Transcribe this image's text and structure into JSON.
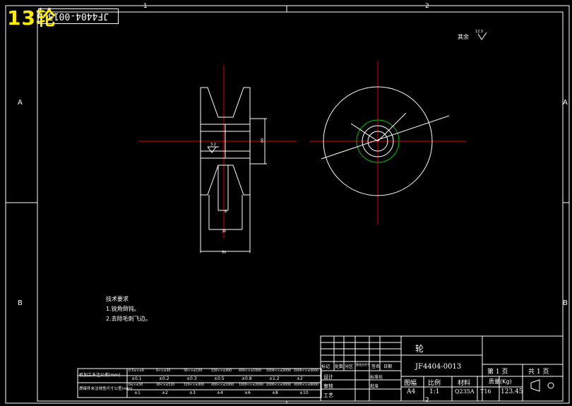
{
  "overlay": {
    "label": "13轮"
  },
  "code_box": {
    "text": "JF4404-0013"
  },
  "frame": {
    "col_top_1": "1",
    "col_top_2": "2",
    "col_bot_1": "1",
    "col_bot_2": "2",
    "row_left_a": "A",
    "row_left_b": "B",
    "row_right_a": "A",
    "row_right_b": "B"
  },
  "roughness": {
    "label": "其余",
    "value": "12.5"
  },
  "section_view": {
    "roughness_value": "3.2"
  },
  "tech_requirements": {
    "title": "技术要求",
    "items": [
      "1.锐角倒钝。",
      "2.去除毛刺飞边。"
    ]
  },
  "tolerance_table": {
    "row1_label": "机加工未注公差(mm)",
    "row1_ranges": [
      "0.5≤×≤6",
      "6<×≤30",
      "30<×≤120",
      "120<×≤400",
      "400<×≤1000",
      "1000<×≤2000",
      "2000<×≤4000"
    ],
    "row1_values": [
      "±0.1",
      "±0.2",
      "±0.3",
      "±0.5",
      "±0.8",
      "±1.2",
      "±2"
    ],
    "row2_label": "焊接件未注线性尺寸公差(mm)",
    "row2_ranges": [
      "0≤×≤30",
      "30<×≤120",
      "120<×≤400",
      "400<×≤1000",
      "1000<×≤2000",
      "2000<×≤4000",
      "4000<×≤8000"
    ],
    "row2_values": [
      "±1",
      "±2",
      "±3",
      "±4",
      "±6",
      "±8",
      "±10"
    ]
  },
  "title_block": {
    "part_name": "轮",
    "drawing_no": "JF4404-0013",
    "rev_headers": [
      "标记",
      "处数",
      "分区",
      "更改文件号",
      "签名",
      "日期"
    ],
    "sign_rows": [
      "设计",
      "审核",
      "工艺"
    ],
    "sign_cols": [
      "标准化",
      "批准"
    ],
    "sheet": "第 1 页",
    "total": "共 1 页",
    "size_label": "图幅",
    "scale_label": "比例",
    "material_label": "材料",
    "mass_label": "质量(Kg)",
    "size": "A4",
    "scale": "1:1",
    "material": "Q235A",
    "blank": "T16",
    "mass": "123.45"
  }
}
